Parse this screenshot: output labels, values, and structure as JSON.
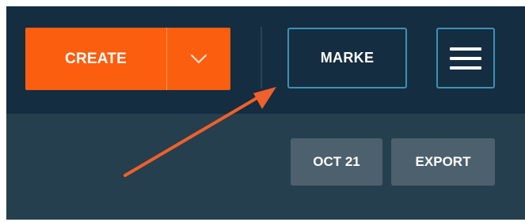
{
  "toolbar": {
    "create_label": "CREATE",
    "create_toggle_icon": "chevron-down-icon",
    "marke_label": "MARKE",
    "menu_icon": "hamburger-menu-icon"
  },
  "subtoolbar": {
    "date_label": "OCT 21",
    "export_label": "EXPORT"
  },
  "annotation": {
    "arrow_color": "#f0602a"
  },
  "colors": {
    "topbar_bg": "#152d40",
    "subbar_bg": "#263f4e",
    "create_accent": "#fb5e0e",
    "outline_accent": "#3b92b6",
    "pill_bg": "#4c606d"
  }
}
